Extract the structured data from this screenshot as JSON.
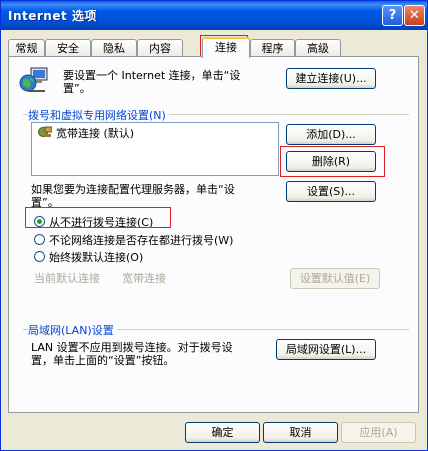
{
  "window": {
    "title": "Internet 选项",
    "help_icon": "?",
    "close_icon": "✕"
  },
  "tabs": [
    {
      "label": "常规"
    },
    {
      "label": "安全"
    },
    {
      "label": "隐私"
    },
    {
      "label": "内容"
    },
    {
      "label": "连接",
      "active": true
    },
    {
      "label": "程序"
    },
    {
      "label": "高级"
    }
  ],
  "setup": {
    "text_line1": "要设置一个 Internet 连接，单击“设",
    "text_line2": "置”。",
    "button": "建立连接(U)..."
  },
  "dialup": {
    "group_label": "拨号和虚拟专用网络设置(N)",
    "connections": [
      "宽带连接 (默认)"
    ],
    "add_button": "添加(D)...",
    "remove_button": "删除(R)",
    "proxy_text_line1": "如果您要为连接配置代理服务器，单击“设",
    "proxy_text_line2": "置”。",
    "settings_button": "设置(S)...",
    "radio_options": [
      {
        "label": "从不进行拨号连接(C)",
        "selected": true
      },
      {
        "label": "不论网络连接是否存在都进行拨号(W)",
        "selected": false
      },
      {
        "label": "始终拨默认连接(O)",
        "selected": false
      }
    ],
    "current_default_label": "当前默认连接",
    "current_default_value": "宽带连接",
    "set_default_button": "设置默认值(E)"
  },
  "lan": {
    "group_label": "局域网(LAN)设置",
    "text_line1": "LAN 设置不应用到拨号连接。对于拨号设",
    "text_line2": "置，单击上面的“设置”按钮。",
    "button": "局域网设置(L)..."
  },
  "footer": {
    "ok": "确定",
    "cancel": "取消",
    "apply": "应用(A)"
  },
  "colors": {
    "titlebar": "#0058e6",
    "highlight_box": "#e02020",
    "group_label": "#0046d5",
    "tab_active_border": "#ffc83c"
  }
}
